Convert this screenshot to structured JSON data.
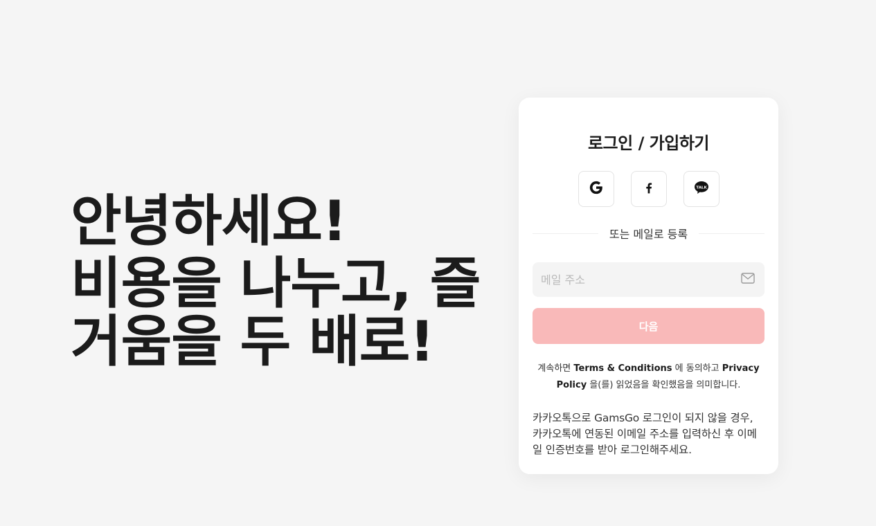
{
  "hero": {
    "line1": "안녕하세요!",
    "line2": "비용을 나누고, 즐",
    "line3": "거움을 두 배로!"
  },
  "login": {
    "title": "로그인 / 가입하기",
    "social": [
      {
        "name": "google",
        "icon": "google-icon"
      },
      {
        "name": "facebook",
        "icon": "facebook-icon"
      },
      {
        "name": "kakao",
        "icon": "kakaotalk-icon",
        "icon_text": "TALK"
      }
    ],
    "divider_text": "또는 메일로 등록",
    "email": {
      "placeholder": "메일 주소",
      "value": "",
      "icon": "mail-icon"
    },
    "next_label": "다음",
    "next_color": "#f9b9b9",
    "terms": {
      "prefix": "계속하면",
      "terms_link": "Terms & Conditions",
      "middle": "에 동의하고",
      "privacy_link": "Privacy Policy",
      "suffix": "을(를) 읽었음을 확인했음을 의미합니다."
    },
    "kakao_note": "카카오톡으로 GamsGo 로그인이 되지 않을 경우, 카카오톡에 연동된 이메일 주소를 입력하신 후 이메일 인증번호를 받아 로그인해주세요."
  }
}
